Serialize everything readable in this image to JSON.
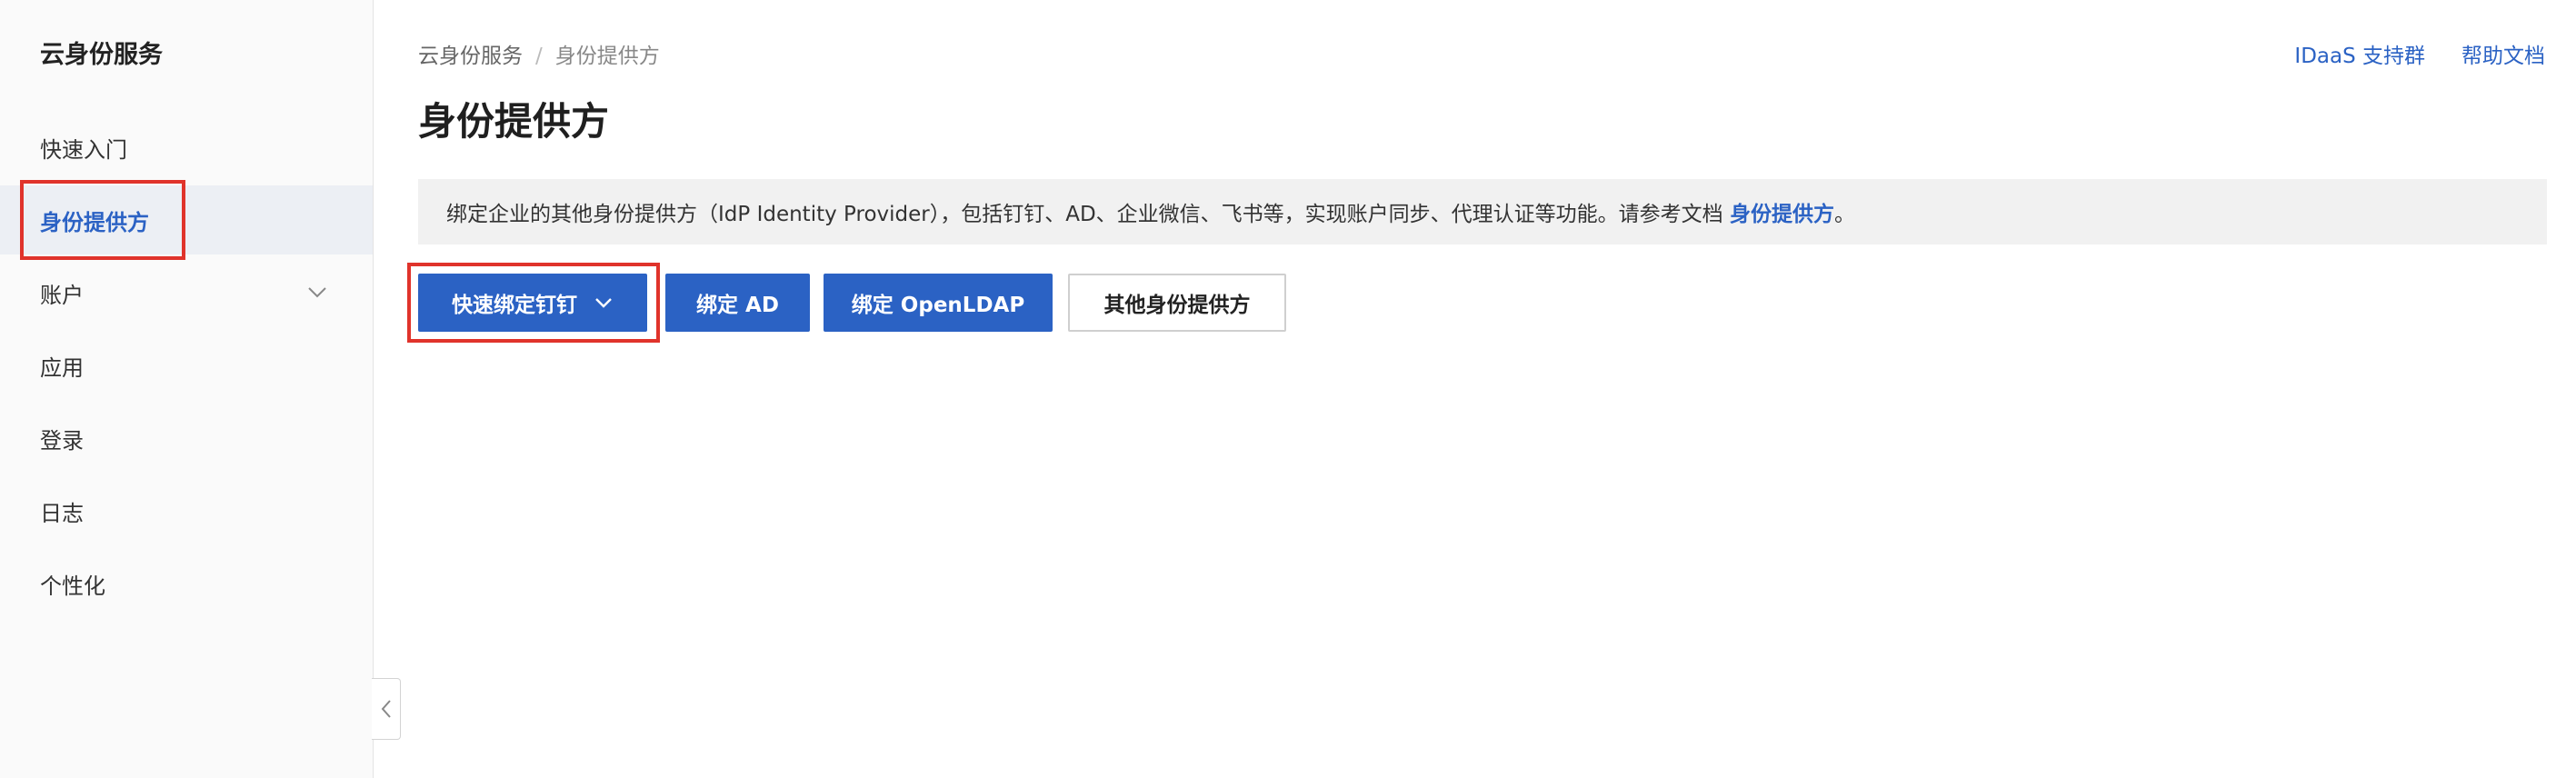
{
  "sidebar": {
    "title": "云身份服务",
    "items": [
      {
        "label": "快速入门"
      },
      {
        "label": "身份提供方"
      },
      {
        "label": "账户"
      },
      {
        "label": "应用"
      },
      {
        "label": "登录"
      },
      {
        "label": "日志"
      },
      {
        "label": "个性化"
      }
    ],
    "active_index": 1
  },
  "header": {
    "breadcrumb": {
      "root": "云身份服务",
      "separator": "/",
      "current": "身份提供方"
    },
    "links": {
      "support": "IDaaS 支持群",
      "docs": "帮助文档"
    },
    "title": "身份提供方"
  },
  "notice": {
    "text": "绑定企业的其他身份提供方（IdP Identity Provider），包括钉钉、AD、企业微信、飞书等，实现账户同步、代理认证等功能。请参考文档 ",
    "link": "身份提供方",
    "suffix": "。"
  },
  "actions": {
    "bind_dingtalk": "快速绑定钉钉",
    "bind_ad": "绑定 AD",
    "bind_openldap": "绑定 OpenLDAP",
    "other_idp": "其他身份提供方"
  },
  "icons": {
    "account_expand": "chevron-down-icon",
    "dingtalk_dropdown": "chevron-down-icon",
    "collapse_sidebar": "chevron-left-icon"
  },
  "colors": {
    "accent": "#2b62c4",
    "highlight": "#e0332b",
    "sidebar_bg": "#fafafa",
    "active_bg": "#eceff4",
    "notice_bg": "#f1f1f1"
  }
}
